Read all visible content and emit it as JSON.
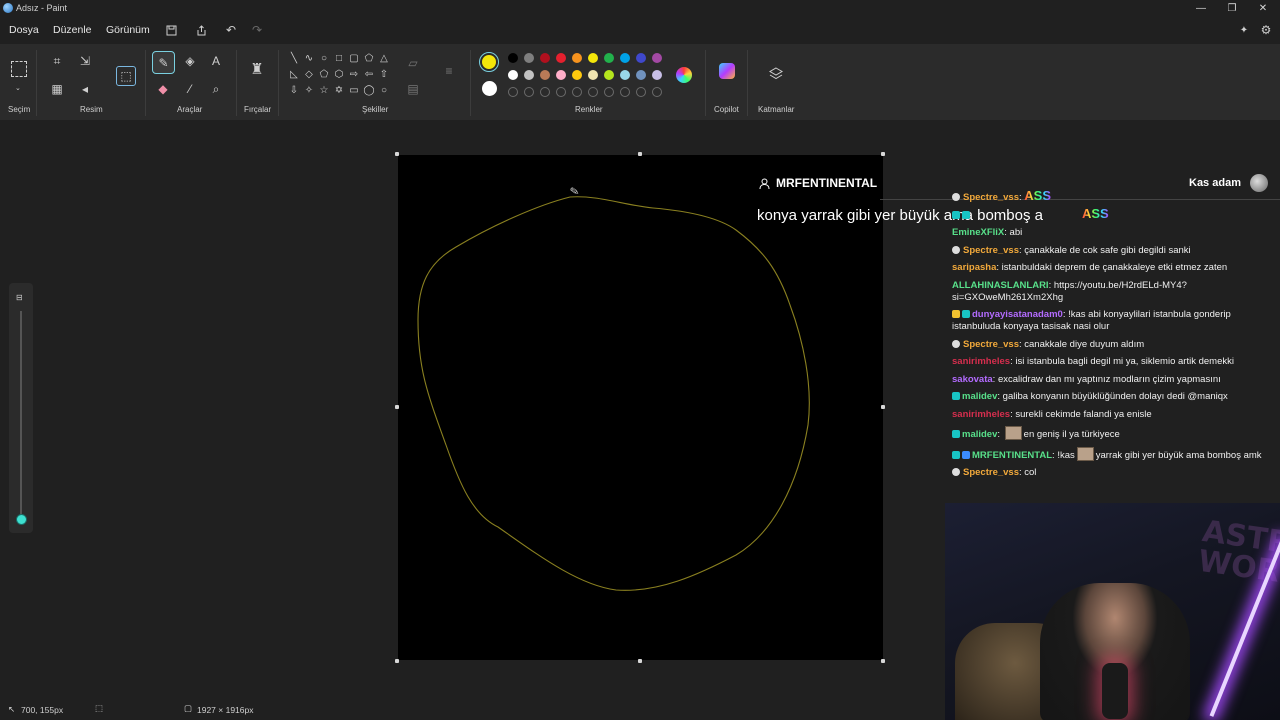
{
  "window": {
    "title": "Adsız - Paint",
    "controls": [
      "—",
      "❐",
      "✕"
    ]
  },
  "menu": {
    "items": [
      "Dosya",
      "Düzenle",
      "Görünüm"
    ]
  },
  "ribbon": {
    "groups": {
      "selection": "Seçim",
      "image": "Resim",
      "tools": "Araçlar",
      "brushes": "Fırçalar",
      "shapes": "Şekiller",
      "colors": "Renkler",
      "copilot": "Copilot",
      "layers": "Katmanlar"
    }
  },
  "colors": {
    "primary": "#f4e60a",
    "secondary": "#ffffff",
    "row1": [
      "#000000",
      "#7f7f7f",
      "#b0101e",
      "#e5202e",
      "#f7931e",
      "#f4e60a",
      "#22b14c",
      "#00a2e8",
      "#3f48cc",
      "#a349a4"
    ],
    "row2": [
      "#ffffff",
      "#c3c3c3",
      "#b97a57",
      "#ffaec9",
      "#ffc90e",
      "#efe4b0",
      "#b5e61d",
      "#99d9ea",
      "#7092be",
      "#c8bfe7"
    ]
  },
  "status": {
    "cursor_position": "700, 155px",
    "canvas_size": "1927 × 1916px"
  },
  "overlay": {
    "alert_user": "MRFENTINENTAL",
    "alert_message": "konya yarrak gibi yer büyük ama bomboş a",
    "chat_title": "Kas adam",
    "chat": [
      {
        "user": "Spectre_vss",
        "color": "#f2a93b",
        "text": "",
        "tag": "ASS"
      },
      {
        "user": "",
        "color": "#b36bff",
        "text": "",
        "tag": "ASS"
      },
      {
        "user": "EmineXFliX",
        "color": "#58e08a",
        "text": "abi"
      },
      {
        "user": "Spectre_vss",
        "color": "#f2a93b",
        "text": "çanakkale de cok safe gibi degildi sanki"
      },
      {
        "user": "saripasha",
        "color": "#f2a93b",
        "text": "istanbuldaki deprem de çanakkaleye etki etmez zaten"
      },
      {
        "user": "ALLAHINASLANLARI",
        "color": "#58e08a",
        "text": "https://youtu.be/H2rdELd-MY4?si=GXOweMh261Xm2Xhg"
      },
      {
        "user": "dunyayisatanadam0",
        "color": "#b36bff",
        "text": "!kas abi konyaylilari istanbula gonderip istanbuluda konyaya tasisak nasi olur"
      },
      {
        "user": "Spectre_vss",
        "color": "#f2a93b",
        "text": "canakkale diye duyum aldım"
      },
      {
        "user": "sanirimheles",
        "color": "#d62e4e",
        "text": "isi istanbula bagli degil mi ya, siklemio artik demekki"
      },
      {
        "user": "sakovata",
        "color": "#b36bff",
        "text": "excalidraw dan mı yaptınız modların çizim yapmasını"
      },
      {
        "user": "malidev",
        "color": "#58e08a",
        "text": "galiba konyanın büyüklüğünden dolayı dedi @maniqx"
      },
      {
        "user": "sanirimheles",
        "color": "#d62e4e",
        "text": "surekli cekimde falandi ya enisle"
      },
      {
        "user": "malidev",
        "color": "#58e08a",
        "text": "en geniş il ya türkiyece"
      },
      {
        "user": "MRFENTINENTAL",
        "color": "#58e08a",
        "text": "!kas",
        "text2": "yarrak gibi yer büyük ama bomboş amk"
      },
      {
        "user": "Spectre_vss",
        "color": "#f2a93b",
        "text": "col"
      }
    ],
    "poster_text": "ASTRO WORLD"
  }
}
